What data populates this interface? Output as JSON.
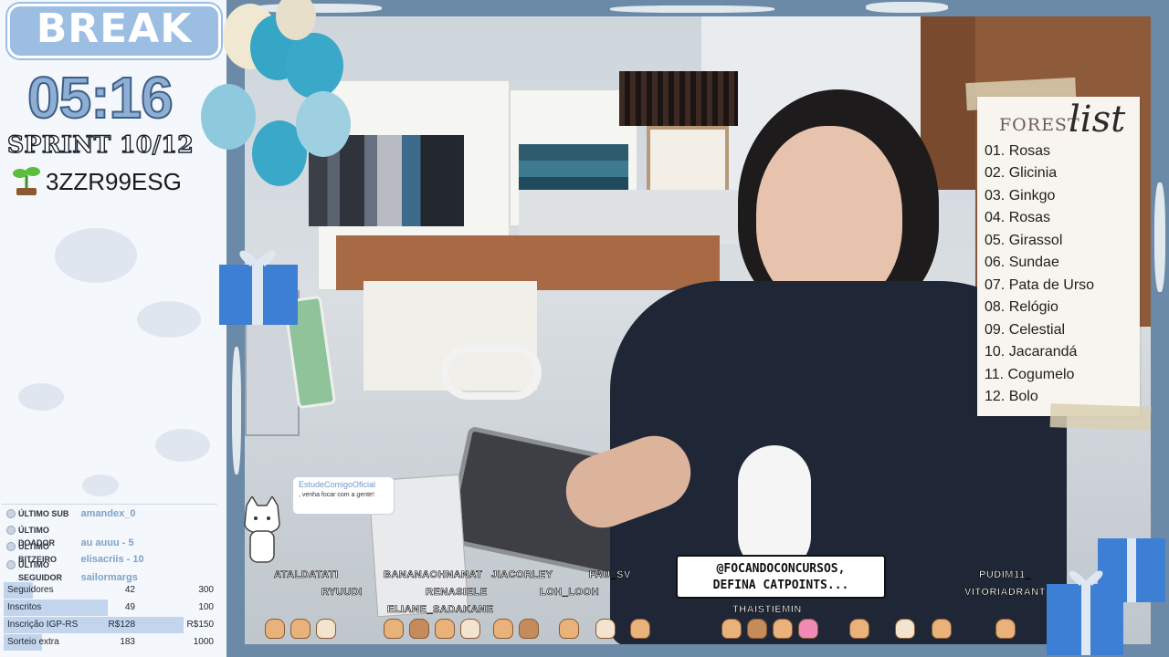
{
  "panel": {
    "break_label": "BREAK",
    "timer": "05:16",
    "sprint": "SPRINT 10/12",
    "code": "3ZZR99ESG"
  },
  "events": [
    {
      "key": "ÚLTIMO SUB",
      "value": "amandex_0"
    },
    {
      "key": "ÚLTIMO DOADOR",
      "value": "au auuu - 5"
    },
    {
      "key": "ÚLTIMO BITZEIRO",
      "value": "elisacriis - 10"
    },
    {
      "key": "ÚLTIMO SEGUIDOR",
      "value": "sailormargs"
    }
  ],
  "goals": [
    {
      "label": "Seguidores",
      "current": "42",
      "target": "300",
      "progress": 0.14
    },
    {
      "label": "Inscritos",
      "current": "49",
      "target": "100",
      "progress": 0.49
    },
    {
      "label": "Inscrição IGP-RS",
      "current": "R$128",
      "target": "R$150",
      "progress": 0.85
    },
    {
      "label": "Sorteio extra",
      "current": "183",
      "target": "1000",
      "progress": 0.18
    }
  ],
  "forest": {
    "title": "FOREST",
    "title_script": "list",
    "items": [
      "01. Rosas",
      "02. Glicinia",
      "03. Ginkgo",
      "04. Rosas",
      "05. Girassol",
      "06. Sundae",
      "07. Pata de Urso",
      "08. Relógio",
      "09. Celestial",
      "10. Jacarandá",
      "11. Cogumelo",
      "12. Bolo"
    ]
  },
  "chat_bubble": {
    "line1": "@FOCANDOCONCURSOS,",
    "line2": "DEFINA CATPOINTS..."
  },
  "cat_message": {
    "name": "EstudeComigoOficial",
    "text": ", venha focar com a gente!"
  },
  "viewers": [
    "ATALDATATI",
    "RYUUDI",
    "BANANAOHNANAT",
    "RENASIELE",
    "ELIANE_SADAKANE",
    "JIACORLEY",
    "LOH_LOOH",
    "FAU_SV",
    "THAISTIEMIN",
    "PUDIM11_",
    "VITORIADRANT"
  ],
  "colors": {
    "accent_blue": "#9cbee3",
    "timer_blue": "#8eaed4",
    "goal_bar": "#c2d5ec"
  }
}
